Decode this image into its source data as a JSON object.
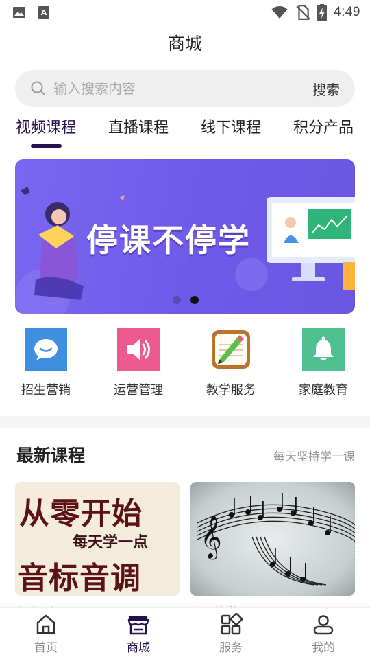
{
  "status_bar": {
    "time": "4:49",
    "left_icons": [
      "image-icon",
      "text-a-icon"
    ],
    "right_icons": [
      "wifi-icon",
      "no-sim-icon",
      "battery-charging-icon"
    ]
  },
  "header": {
    "title": "商城"
  },
  "search": {
    "placeholder": "输入搜索内容",
    "value": "",
    "button_label": "搜索"
  },
  "tabs": [
    {
      "label": "视频课程",
      "active": true
    },
    {
      "label": "直播课程",
      "active": false
    },
    {
      "label": "线下课程",
      "active": false
    },
    {
      "label": "积分产品",
      "active": false
    }
  ],
  "banner": {
    "text": "停课不停学",
    "dots": 2,
    "active_dot": 2,
    "background": "#7a67f0"
  },
  "categories": [
    {
      "label": "招生营销",
      "icon": "chat-bubble-icon",
      "color": "#3f8fe0"
    },
    {
      "label": "运营管理",
      "icon": "speaker-icon",
      "color": "#ee5a8f"
    },
    {
      "label": "教学服务",
      "icon": "notepad-pencil-icon",
      "color": "#b8732f"
    },
    {
      "label": "家庭教育",
      "icon": "bell-icon",
      "color": "#4fbf8f"
    }
  ],
  "latest": {
    "title": "最新课程",
    "subtitle": "每天坚持学一课",
    "courses": [
      {
        "title": "音准入门",
        "image_lines": [
          "从零开始",
          "每天学一点",
          "音标音调"
        ]
      },
      {
        "title": "钢琴教学",
        "image": "music-notes-image"
      }
    ]
  },
  "bottom_nav": [
    {
      "label": "首页",
      "icon": "home-icon",
      "active": false
    },
    {
      "label": "商城",
      "icon": "shop-icon",
      "active": true
    },
    {
      "label": "服务",
      "icon": "grid-icon",
      "active": false
    },
    {
      "label": "我的",
      "icon": "user-icon",
      "active": false
    }
  ],
  "colors": {
    "accent": "#24124f",
    "search_bg": "#efefef",
    "muted": "#999999"
  }
}
